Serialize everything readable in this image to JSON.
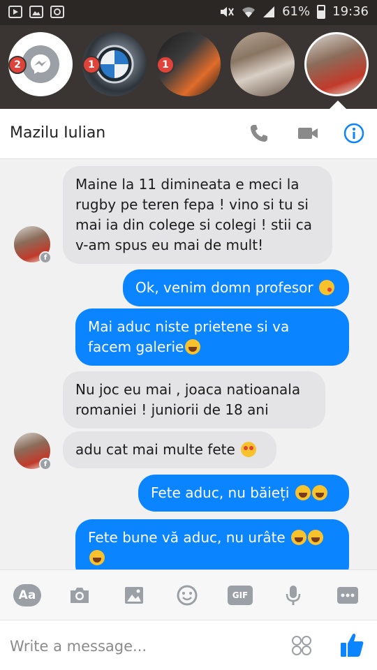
{
  "status_bar": {
    "icons_left": [
      "youtube-icon",
      "gallery-icon",
      "recycle-icon"
    ],
    "icons_right": [
      "mute-icon",
      "wifi-icon",
      "signal-icon"
    ],
    "battery": "61%",
    "time": "19:36"
  },
  "chat_heads": [
    {
      "type": "messenger",
      "badge": "2"
    },
    {
      "type": "photo",
      "badge": "1"
    },
    {
      "type": "photo",
      "badge": "1"
    },
    {
      "type": "photo",
      "badge": ""
    },
    {
      "type": "photo",
      "badge": "",
      "active": true
    }
  ],
  "header": {
    "contact_name": "Mazilu Iulian"
  },
  "messages": [
    {
      "from": "them",
      "text": "Maine la 11 dimineata e meci la rugby pe teren fepa ! vino si tu si mai ia din colege si colegi ! stii ca v-am spus eu mai de mult!"
    },
    {
      "from": "me",
      "text": "Ok, venim domn profesor",
      "emoji": "kiss-emoji"
    },
    {
      "from": "me",
      "text": "Mai aduc niste prietene si va facem galerie",
      "emoji": "laugh-emoji"
    },
    {
      "from": "them",
      "text": "Nu joc eu mai , joaca natioanala romaniei ! juniorii de 18 ani"
    },
    {
      "from": "them",
      "text": "adu cat mai multe fete",
      "emoji": "heart-eyes-emoji"
    },
    {
      "from": "me",
      "text": "Fete aduc, nu băieți",
      "emoji": "laugh-emoji x2"
    },
    {
      "from": "me",
      "text": "Fete bune vă aduc, nu urâte",
      "emoji": "laugh-emoji x3"
    }
  ],
  "toolbar": {
    "aa_label": "Aa",
    "gif_label": "GIF",
    "icons": [
      "text-format-icon",
      "camera-icon",
      "image-icon",
      "emoji-icon",
      "gif-icon",
      "microphone-icon",
      "more-icon"
    ]
  },
  "composer": {
    "placeholder": "Write a message..."
  },
  "colors": {
    "accent": "#0b84ff",
    "incoming_bubble": "#e4e4e6",
    "badge": "#e0433a"
  }
}
